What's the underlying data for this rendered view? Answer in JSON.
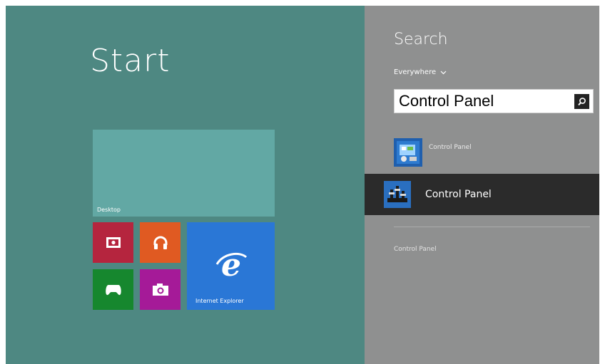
{
  "start": {
    "title": "Start",
    "tiles": {
      "desktop": "Desktop",
      "video": "video-icon",
      "music": "headphones-icon",
      "games": "gamepad-icon",
      "camera": "camera-icon",
      "ie": "Internet Explorer"
    }
  },
  "search": {
    "title": "Search",
    "scope": "Everywhere",
    "query": "Control Panel",
    "results": [
      {
        "label": "Control Panel"
      },
      {
        "label": "Control Panel"
      }
    ],
    "category": "Control Panel"
  },
  "colors": {
    "start_bg": "#4e8882",
    "charm_bg": "#8f9090",
    "selected_bg": "#2b2b2b",
    "ie_tile": "#2a77d6"
  }
}
